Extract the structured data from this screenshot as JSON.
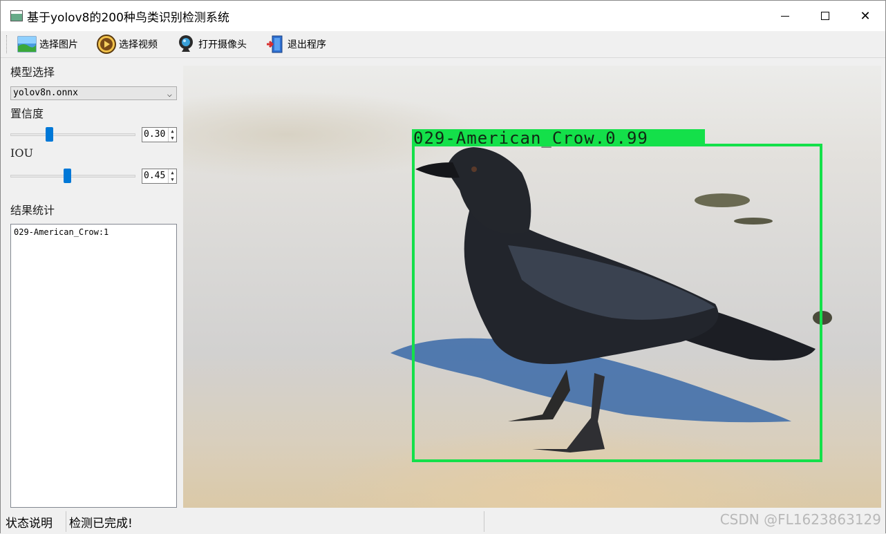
{
  "window": {
    "title": "基于yolov8的200种鸟类识别检测系统",
    "minimize_glyph": "—",
    "close_glyph": "✕"
  },
  "toolbar": {
    "items": [
      {
        "label": "选择图片",
        "icon": "image-icon"
      },
      {
        "label": "选择视频",
        "icon": "video-play-icon"
      },
      {
        "label": "打开摄像头",
        "icon": "webcam-icon"
      },
      {
        "label": "退出程序",
        "icon": "exit-door-icon"
      }
    ]
  },
  "left_panel": {
    "model_label": "模型选择",
    "model_selected": "yolov8n.onnx",
    "confidence_label": "置信度",
    "confidence_value": "0.30",
    "confidence_fraction": 0.3,
    "iou_label": "IOU",
    "iou_value": "0.45",
    "iou_fraction": 0.45,
    "results_label": "结果统计",
    "results_text": "029-American_Crow:1"
  },
  "detection": {
    "label": "029-American_Crow,0.99",
    "box_color": "#14e04a"
  },
  "statusbar": {
    "label": "状态说明",
    "value": "检测已完成!"
  },
  "watermark": "CSDN @FL1623863129"
}
